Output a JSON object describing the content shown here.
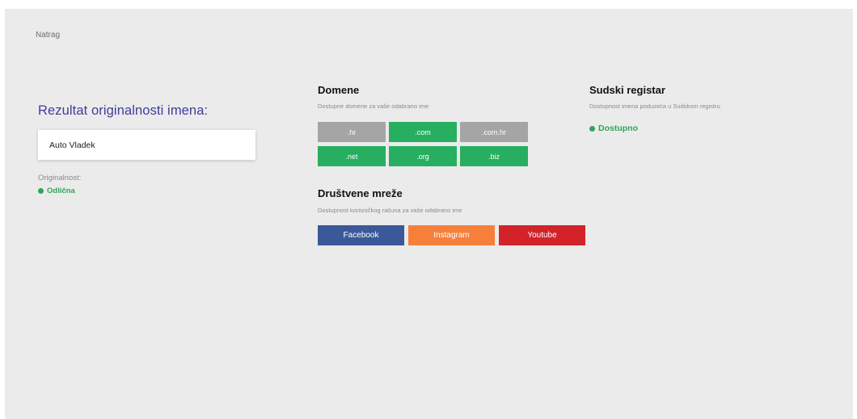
{
  "nav": {
    "back_label": "Natrag"
  },
  "result": {
    "title": "Rezultat originalnosti imena:",
    "name_value": "Auto Vladek",
    "originality_label": "Originalnost:",
    "originality_status": "Odlična",
    "status_color": "#2fa65a"
  },
  "domains": {
    "title": "Domene",
    "subtitle": "Dostupne domene za vaše odabrano ime",
    "items": [
      {
        "label": ".hr",
        "available": false
      },
      {
        "label": ".com",
        "available": true
      },
      {
        "label": ".com.hr",
        "available": false
      },
      {
        "label": ".net",
        "available": true
      },
      {
        "label": ".org",
        "available": true
      },
      {
        "label": ".biz",
        "available": true
      }
    ],
    "available_color": "#27ae60",
    "taken_color": "#a5a5a5"
  },
  "social": {
    "title": "Društvene mreže",
    "subtitle": "Dostupnost korisničkog računa za vaše odabrano ime",
    "items": [
      {
        "label": "Facebook",
        "color": "#3b5998"
      },
      {
        "label": "Instagram",
        "color": "#f77f3a"
      },
      {
        "label": "Youtube",
        "color": "#d2232a"
      }
    ]
  },
  "court_registry": {
    "title": "Sudski registar",
    "subtitle": "Dostupnost imena poduzeća u Sudskom registru",
    "status": "Dostupno"
  },
  "colors": {
    "accent_title": "#3f3d9c",
    "background": "#ebebeb"
  }
}
